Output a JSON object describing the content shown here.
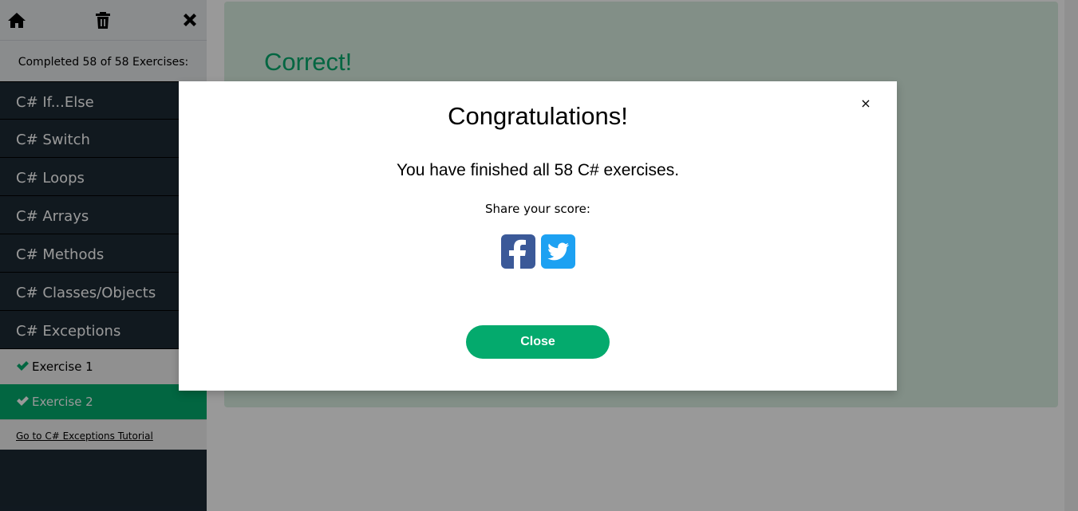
{
  "sidebar": {
    "toolbar": {
      "home_icon": "home-icon",
      "trash_icon": "trash-icon",
      "close_icon": "close-icon"
    },
    "progress_text": "Completed 58 of 58 Exercises:",
    "items": [
      {
        "label": "C# If...Else"
      },
      {
        "label": "C# Switch"
      },
      {
        "label": "C# Loops"
      },
      {
        "label": "C# Arrays"
      },
      {
        "label": "C# Methods"
      },
      {
        "label": "C# Classes/Objects"
      },
      {
        "label": "C# Exceptions"
      }
    ],
    "exercises": [
      {
        "label": "Exercise 1",
        "completed": true,
        "active": false
      },
      {
        "label": "Exercise 2",
        "completed": true,
        "active": true
      }
    ],
    "tutorial_link": "Go to C# Exceptions Tutorial"
  },
  "main": {
    "result_title": "Correct!"
  },
  "modal": {
    "title": "Congratulations!",
    "message": "You have finished all 58 C# exercises.",
    "share_label": "Share your score:",
    "share_icons": [
      "facebook-icon",
      "twitter-icon"
    ],
    "close_symbol": "×",
    "close_button": "Close"
  },
  "colors": {
    "accent": "#04aa6d",
    "sidebar_bg": "#1d2a35",
    "facebook": "#3b5998",
    "twitter": "#1da1f2"
  }
}
